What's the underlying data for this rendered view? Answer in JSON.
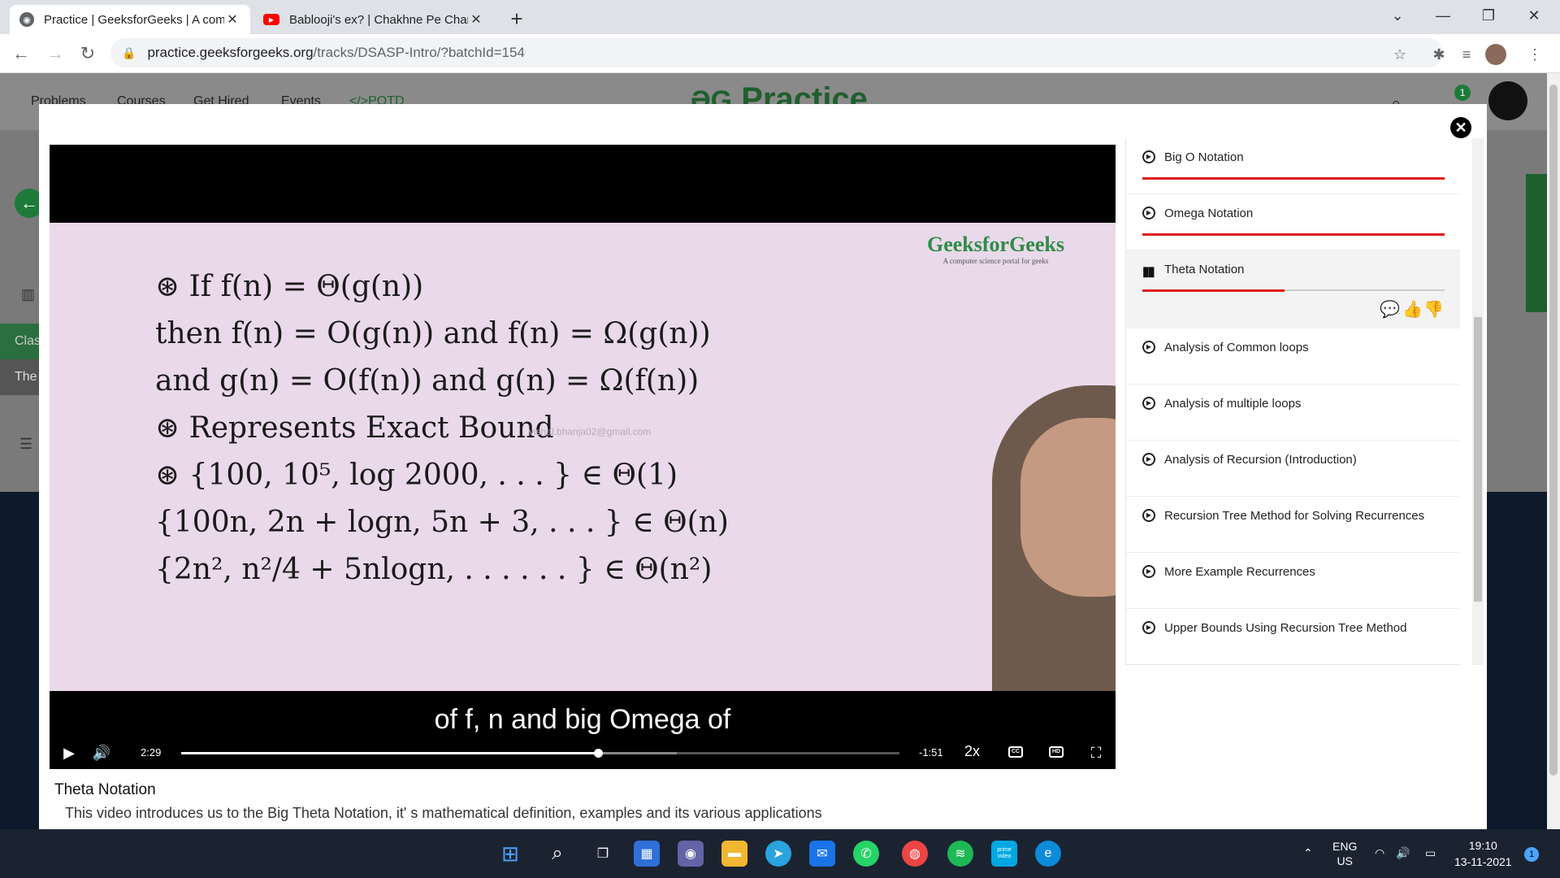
{
  "browser": {
    "tabs": [
      {
        "title": "Practice | GeeksforGeeks | A com",
        "active": true
      },
      {
        "title": "Bablooji's ex? | Chakhne Pe Charc",
        "active": false
      }
    ],
    "url_host": "practice.geeksforgeeks.org",
    "url_path": "/tracks/DSASP-Intro/?batchId=154"
  },
  "background_page": {
    "nav_items": [
      "Problems",
      "Courses",
      "Get Hired",
      "Events",
      "</>POTD"
    ],
    "brand": "Practice",
    "notification_count": "1",
    "side_labels": [
      "Clas",
      "The"
    ]
  },
  "video": {
    "board_logo": "GeeksforGeeks",
    "board_logo_tagline": "A computer science portal for geeks",
    "board_lines": [
      "⊛  If  f(n) = Θ(g(n))",
      "     then  f(n) = O(g(n))  and  f(n) = Ω(g(n))",
      "     and  g(n) = O(f(n))  and  g(n) = Ω(f(n))",
      "⊛  Represents Exact Bound",
      "⊛  {100,  10⁵,  log 2000, . . . } ∈ Θ(1)",
      "     {100n,  2n + logn,  5n + 3, . . . } ∈ Θ(n)",
      "     {2n²,  n²/4 + 5nlogn,  . . . . . . } ∈ Θ(n²)"
    ],
    "watermark": "vishal.bhanja02@gmail.com",
    "subtitle": "of f, n and big Omega of",
    "elapsed": "2:29",
    "remaining": "-1:51",
    "speed": "2x",
    "progress_played": 0.58,
    "progress_buffered": 0.69,
    "title": "Theta Notation",
    "description": "This video introduces us to the Big Theta Notation, it' s mathematical definition, examples and its various applications"
  },
  "playlist": {
    "items": [
      {
        "label": "Big O Notation",
        "progress": 1.0
      },
      {
        "label": "Omega Notation",
        "progress": 1.0
      },
      {
        "label": "Theta Notation",
        "progress": 0.47,
        "active": true
      },
      {
        "label": "Analysis of Common loops"
      },
      {
        "label": "Analysis of multiple loops"
      },
      {
        "label": "Analysis of Recursion (Introduction)"
      },
      {
        "label": "Recursion Tree Method for Solving Recurrences"
      },
      {
        "label": "More Example Recurrences"
      },
      {
        "label": "Upper Bounds Using Recursion Tree Method"
      }
    ]
  },
  "taskbar": {
    "lang_line1": "ENG",
    "lang_line2": "US",
    "time": "19:10",
    "date": "13-11-2021",
    "notification_badge": "1",
    "prime_video_label": "prime video"
  },
  "colors": {
    "gfg_green": "#2f8d46",
    "progress_red": "#e01b1b",
    "taskbar_bg": "#1b2331"
  }
}
